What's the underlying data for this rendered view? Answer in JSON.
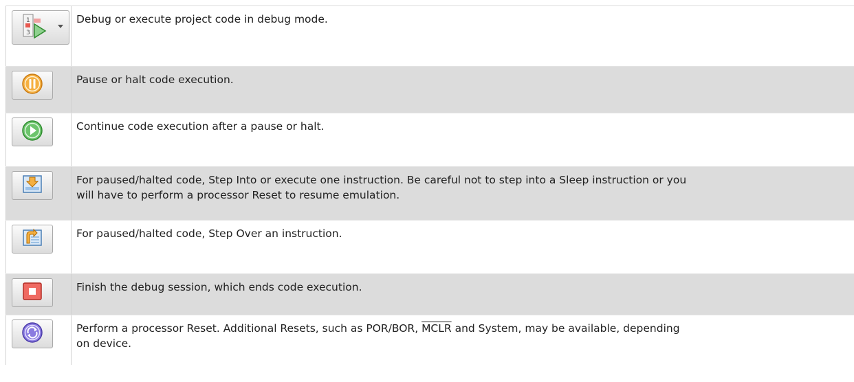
{
  "rows": [
    {
      "icon": "debug-project-icon",
      "has_dropdown": true,
      "text": "Debug or execute project code in debug mode."
    },
    {
      "icon": "pause-icon",
      "text": "Pause or halt code execution."
    },
    {
      "icon": "continue-icon",
      "text": "Continue code execution after a pause or halt."
    },
    {
      "icon": "step-into-icon",
      "text": "For paused/halted code, Step Into or execute one instruction. Be careful not to step into a Sleep instruction or you\nwill have to perform a processor Reset to resume emulation."
    },
    {
      "icon": "step-over-icon",
      "text": "For paused/halted code, Step Over an instruction."
    },
    {
      "icon": "finish-debug-session-icon",
      "text": "Finish the debug session, which ends code execution."
    },
    {
      "icon": "reset-icon",
      "text_before": "Perform a processor Reset. Additional Resets, such as POR/BOR, ",
      "text_overline": "MCLR",
      "text_after": " and System, may be available, depending\non device."
    }
  ],
  "colors": {
    "row_alt": "#dcdcdc",
    "pause": "#f0a030",
    "continue": "#4caf50",
    "stop": "#e8584f",
    "reset": "#6a5acd"
  }
}
